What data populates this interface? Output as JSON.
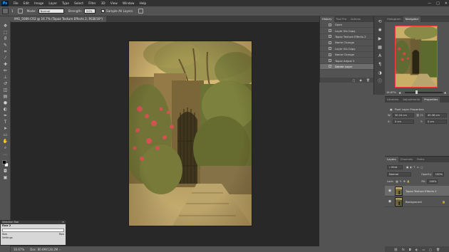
{
  "app": {
    "logo": "Ps"
  },
  "menu": [
    "File",
    "Edit",
    "Image",
    "Layer",
    "Type",
    "Select",
    "Filter",
    "3D",
    "View",
    "Window",
    "Help"
  ],
  "window_controls": [
    "—",
    "□",
    "✕"
  ],
  "options_bar": {
    "brush_size": "1",
    "mode_label": "Mode:",
    "mode_value": "Normal",
    "strength_label": "Strength:",
    "strength_value": "50%",
    "sample_all_layers": "Sample All Layers"
  },
  "document": {
    "tab_title": "IMG_5089.CR2 @ 16.7% (Topaz Texture Effects 2, RGB/16*)",
    "zoom": "16.67%",
    "doc_info": "Doc: 80.6M/128.2M"
  },
  "history": {
    "tabs": [
      "History",
      "Tool Pre",
      "Actions"
    ],
    "items": [
      {
        "label": "Open",
        "selected": false
      },
      {
        "label": "Layer Via Copy",
        "selected": false
      },
      {
        "label": "Topaz Texture Effects 2",
        "selected": false
      },
      {
        "label": "Name Change",
        "selected": false
      },
      {
        "label": "Layer Via Copy",
        "selected": false
      },
      {
        "label": "Name Change",
        "selected": false
      },
      {
        "label": "Topaz Adjust 5",
        "selected": false
      },
      {
        "label": "Delete Layer",
        "selected": true
      }
    ]
  },
  "navigator": {
    "tabs": [
      "Histogram",
      "Navigator"
    ],
    "zoom": "16.67%",
    "zoom_level": 0.28
  },
  "properties": {
    "tabs": [
      "Libraries",
      "Adjustments",
      "Properties"
    ],
    "title": "Pixel Layer Properties",
    "w_label": "W:",
    "w_value": "30.24 cm",
    "h_label": "H:",
    "h_value": "45.36 cm",
    "x_label": "X:",
    "x_value": "0 cm",
    "y_label": "Y:",
    "y_value": "0 cm"
  },
  "layers": {
    "tabs": [
      "Layers",
      "Channels",
      "Paths"
    ],
    "kind_label": "Kind",
    "blend_mode": "Normal",
    "opacity_label": "Opacity:",
    "opacity_value": "100%",
    "lock_label": "Lock:",
    "fill_label": "Fill:",
    "fill_value": "100%",
    "items": [
      {
        "name": "Topaz Texture Effects 2",
        "selected": true
      },
      {
        "name": "Background",
        "selected": false
      }
    ]
  },
  "float_panel": {
    "title": "Selection Tool",
    "name": "Row 2",
    "line2": "",
    "field_left": "Row",
    "field_right": "Row",
    "last": "Settings"
  },
  "colors": {
    "frame": "#535353",
    "canvas": "#282828",
    "menubar": "#323232",
    "nav_box": "#ff3b3b"
  }
}
